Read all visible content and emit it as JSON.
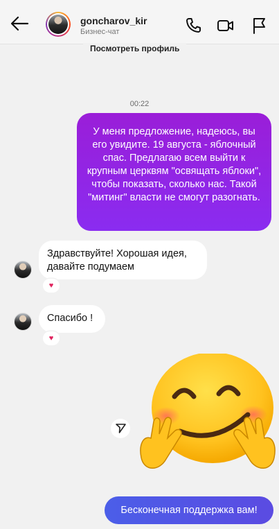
{
  "header": {
    "username": "goncharov_kir",
    "subtitle": "Бизнес-чат",
    "back_icon": "arrow-left-icon",
    "icons": [
      "phone-icon",
      "video-camera-icon",
      "flag-icon"
    ]
  },
  "profile_link": "Посмотреть профиль",
  "timestamp": "00:22",
  "messages": [
    {
      "direction": "outgoing",
      "text": "У меня предложение, надеюсь, вы его увидите. 19 августа - яблочный спас. Предлагаю всем выйти к крупным церквям \"освящать яблоки\", чтобы показать, сколько нас. Такой \"митинг\" власти не смогут разогнать."
    },
    {
      "direction": "incoming",
      "text": "Здравствуйте! Хорошая идея, давайте подумаем",
      "reaction": "♥"
    },
    {
      "direction": "incoming",
      "text": "Спасибо !",
      "reaction": "♥"
    },
    {
      "direction": "outgoing",
      "sticker": "hugging-face-emoji",
      "share_icon": "share-icon"
    },
    {
      "direction": "outgoing",
      "text": "Бесконечная поддержка вам!"
    }
  ],
  "colors": {
    "outgoing_bubble": "#9a1ed8",
    "last_bubble": "#4b5ee8",
    "incoming_bubble": "#ffffff",
    "reaction_heart": "#e0245e"
  }
}
